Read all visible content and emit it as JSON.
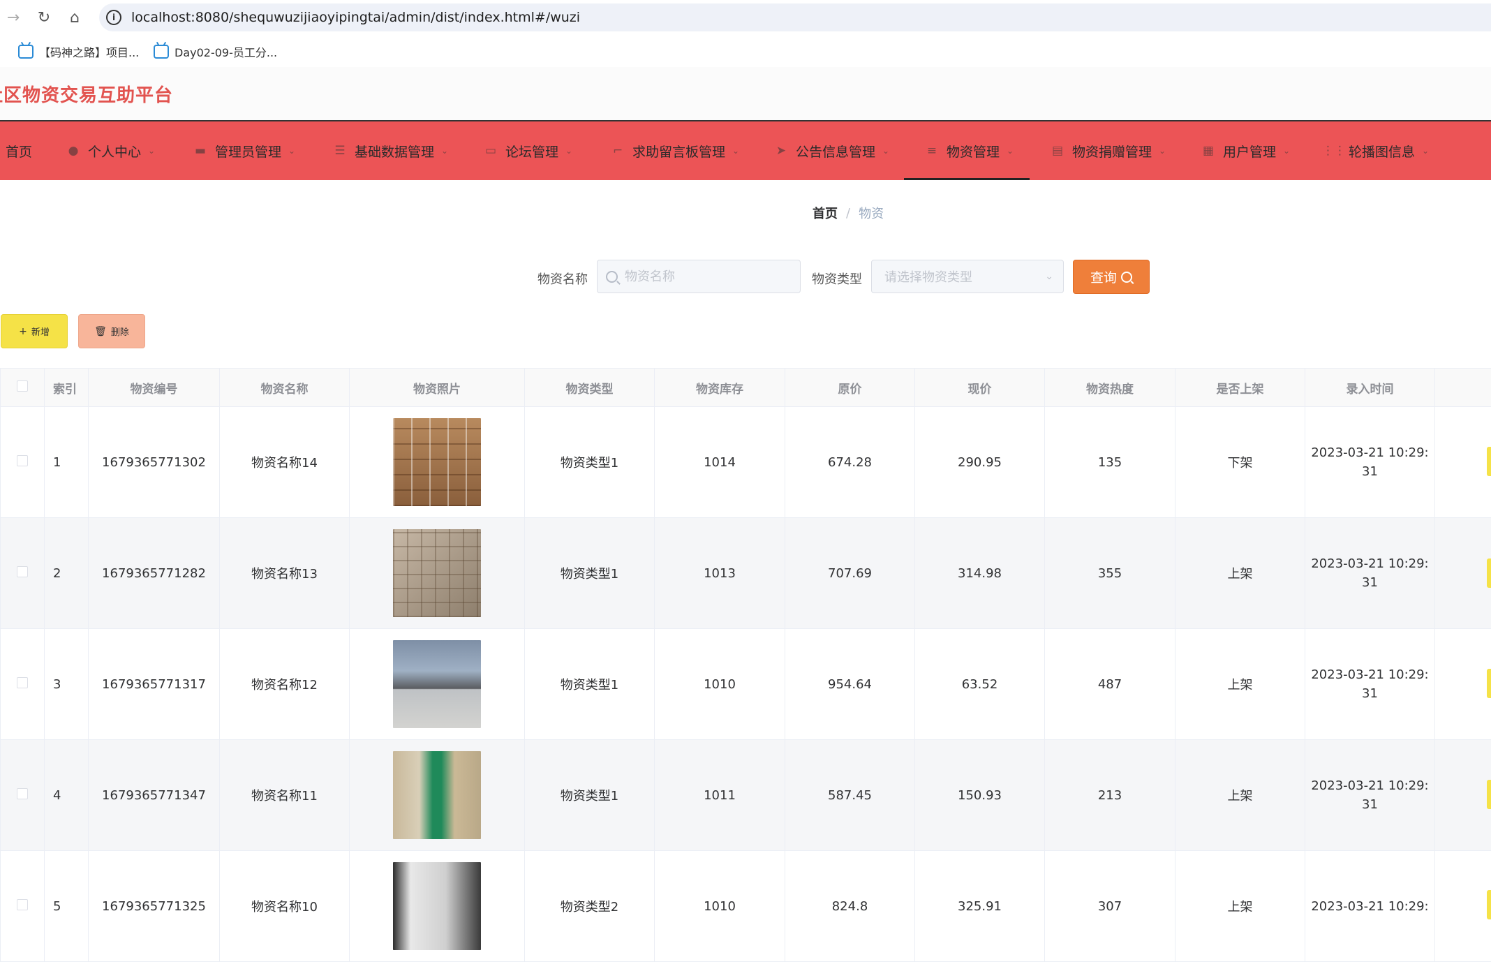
{
  "browser": {
    "url": "localhost:8080/shequwuzijiaoyipingtai/admin/dist/index.html#/wuzi",
    "bookmarks": [
      "【码神之路】项目...",
      "Day02-09-员工分..."
    ]
  },
  "app": {
    "title": "社区物资交易互助平台",
    "accent_color": "#ec5456"
  },
  "menu": {
    "items": [
      {
        "label": "首页",
        "icon": "none"
      },
      {
        "label": "个人中心",
        "icon": "user-icon"
      },
      {
        "label": "管理员管理",
        "icon": "monitor-icon"
      },
      {
        "label": "基础数据管理",
        "icon": "sliders-icon"
      },
      {
        "label": "论坛管理",
        "icon": "chat-icon"
      },
      {
        "label": "求助留言板管理",
        "icon": "crop-icon"
      },
      {
        "label": "公告信息管理",
        "icon": "send-icon"
      },
      {
        "label": "物资管理",
        "icon": "list-icon"
      },
      {
        "label": "物资捐赠管理",
        "icon": "chart-icon"
      },
      {
        "label": "用户管理",
        "icon": "grid-icon"
      },
      {
        "label": "轮播图信息",
        "icon": "apps-icon"
      }
    ],
    "active": "物资管理"
  },
  "breadcrumb": {
    "home": "首页",
    "current": "物资"
  },
  "search": {
    "name_label": "物资名称",
    "name_placeholder": "物资名称",
    "type_label": "物资类型",
    "type_placeholder": "请选择物资类型",
    "query_label": "查询"
  },
  "actions": {
    "add_label": "新增",
    "delete_label": "删除"
  },
  "table": {
    "headers": [
      "索引",
      "物资编号",
      "物资名称",
      "物资照片",
      "物资类型",
      "物资库存",
      "原价",
      "现价",
      "物资热度",
      "是否上架",
      "录入时间"
    ],
    "rows": [
      {
        "index": "1",
        "code": "1679365771302",
        "name": "物资名称14",
        "type": "物资类型1",
        "stock": "1014",
        "orig": "674.28",
        "price": "290.95",
        "heat": "135",
        "status": "下架",
        "time1": "2023-03-21 10:29:",
        "time2": "31"
      },
      {
        "index": "2",
        "code": "1679365771282",
        "name": "物资名称13",
        "type": "物资类型1",
        "stock": "1013",
        "orig": "707.69",
        "price": "314.98",
        "heat": "355",
        "status": "上架",
        "time1": "2023-03-21 10:29:",
        "time2": "31"
      },
      {
        "index": "3",
        "code": "1679365771317",
        "name": "物资名称12",
        "type": "物资类型1",
        "stock": "1010",
        "orig": "954.64",
        "price": "63.52",
        "heat": "487",
        "status": "上架",
        "time1": "2023-03-21 10:29:",
        "time2": "31"
      },
      {
        "index": "4",
        "code": "1679365771347",
        "name": "物资名称11",
        "type": "物资类型1",
        "stock": "1011",
        "orig": "587.45",
        "price": "150.93",
        "heat": "213",
        "status": "上架",
        "time1": "2023-03-21 10:29:",
        "time2": "31"
      },
      {
        "index": "5",
        "code": "1679365771325",
        "name": "物资名称10",
        "type": "物资类型2",
        "stock": "1010",
        "orig": "824.8",
        "price": "325.91",
        "heat": "307",
        "status": "上架",
        "time1": "2023-03-21 10:29:",
        "time2": ""
      }
    ]
  }
}
